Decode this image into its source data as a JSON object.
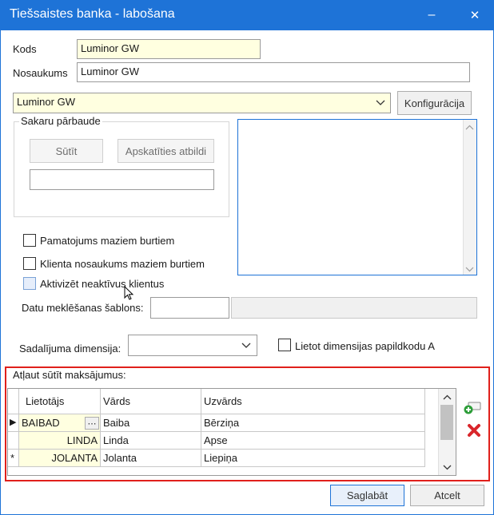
{
  "window": {
    "title": "Tiešsaistes banka - labošana",
    "minimize_glyph": "–",
    "close_glyph": "✕"
  },
  "form": {
    "kods_label": "Kods",
    "kods_value": "Luminor GW",
    "nosaukums_label": "Nosaukums",
    "nosaukums_value": "Luminor GW",
    "bank_select_value": "Luminor GW",
    "config_button": "Konfigurācija",
    "connection_group_title": "Sakaru pārbaude",
    "send_button": "Sūtīt",
    "view_reply_button": "Apskatīties atbildi",
    "checkbox1_label": "Pamatojums maziem burtiem",
    "checkbox2_label": "Klienta nosaukums maziem burtiem",
    "checkbox3_label": "Aktivizēt neaktīvus klientus",
    "search_template_label": "Datu meklēšanas šablons:",
    "dimension_label": "Sadalījuma dimensija:",
    "dimension_value": "",
    "use_dimension_code_label": "Lietot dimensijas papildkodu A"
  },
  "payments": {
    "section_title": "Atļaut sūtīt maksājumus:",
    "columns": [
      "Lietotājs",
      "Vārds",
      "Uzvārds"
    ],
    "rows": [
      {
        "marker": "▶",
        "user": "BAIBAD",
        "first": "Baiba",
        "last": "Bērziņa"
      },
      {
        "marker": "",
        "user": "LINDA",
        "first": "Linda",
        "last": "Apse"
      },
      {
        "marker": "*",
        "user": "JOLANTA",
        "first": "Jolanta",
        "last": "Liepiņa"
      }
    ],
    "ellipsis": "⋯"
  },
  "footer": {
    "save_button": "Saglabāt",
    "cancel_button": "Atcelt"
  },
  "colors": {
    "titlebar": "#1e73d7",
    "highlight_frame": "#e0201b",
    "yellow_field": "#ffffe0"
  },
  "icons": {
    "add_row": "add-row-icon",
    "delete_row": "delete-row-icon",
    "cursor": "mouse-pointer-icon"
  }
}
